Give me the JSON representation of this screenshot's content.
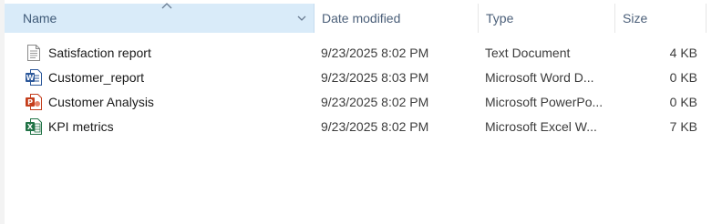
{
  "columns": {
    "name": "Name",
    "date": "Date modified",
    "type": "Type",
    "size": "Size"
  },
  "files": [
    {
      "name": "Satisfaction report",
      "date": "9/23/2025 8:02 PM",
      "type": "Text Document",
      "size": "4 KB",
      "icon": "text-document-icon"
    },
    {
      "name": "Customer_report",
      "date": "9/23/2025 8:03 PM",
      "type": "Microsoft Word D...",
      "size": "0 KB",
      "icon": "word-document-icon"
    },
    {
      "name": "Customer Analysis",
      "date": "9/23/2025 8:02 PM",
      "type": "Microsoft PowerPo...",
      "size": "0 KB",
      "icon": "powerpoint-document-icon"
    },
    {
      "name": "KPI metrics",
      "date": "9/23/2025 8:02 PM",
      "type": "Microsoft Excel W...",
      "size": "7 KB",
      "icon": "excel-workbook-icon"
    }
  ],
  "colors": {
    "header_selected": "#d9ebf9",
    "word": "#2b579a",
    "powerpoint": "#c43e1c",
    "excel": "#217346"
  }
}
